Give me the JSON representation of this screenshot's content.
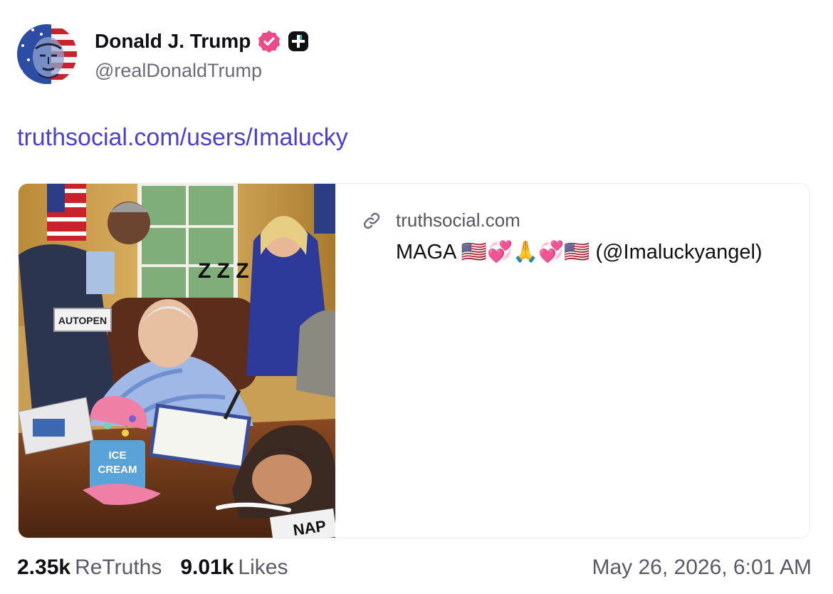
{
  "author": {
    "display_name": "Donald J. Trump",
    "handle": "@realDonaldTrump",
    "verified_badge_icon": "verified-check-icon",
    "truth_plus_icon": "plus-badge-icon",
    "badge_color": "#ea4c89"
  },
  "post": {
    "link_text": "truthsocial.com/users/Imalucky",
    "link_color": "#4a3fcf"
  },
  "link_card": {
    "image_icon": "ai-cartoon-oval-office-image",
    "image_texts": {
      "box_label": "AUTOPEN",
      "zzz": "Z Z Z",
      "cup_label_line1": "ICE",
      "cup_label_line2": "CREAM",
      "newspaper": "NAP"
    },
    "domain_icon": "link-icon",
    "domain": "truthsocial.com",
    "title": "MAGA 🇺🇸💞🙏💞🇺🇸 (@Imaluckyangel)"
  },
  "stats": {
    "retruths_count": "2.35k",
    "retruths_label": "ReTruths",
    "likes_count": "9.01k",
    "likes_label": "Likes",
    "timestamp": "May 26, 2026, 6:01 AM"
  }
}
